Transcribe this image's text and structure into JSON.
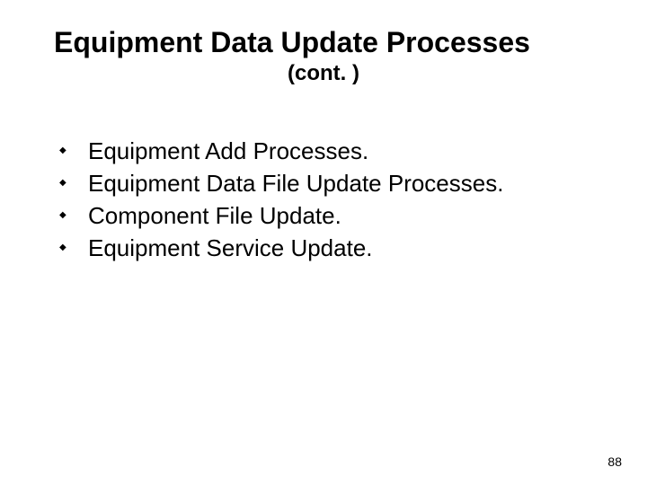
{
  "title": "Equipment Data Update Processes",
  "subtitle": "(cont. )",
  "bullets": [
    "Equipment Add Processes.",
    "Equipment Data File Update Processes.",
    "Component File Update.",
    "Equipment Service Update."
  ],
  "page_number": "88"
}
